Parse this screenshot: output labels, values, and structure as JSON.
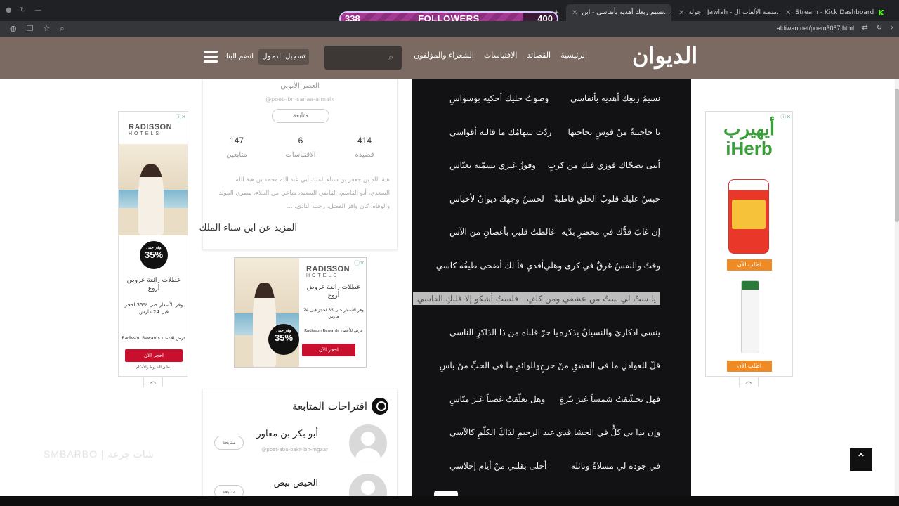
{
  "browser": {
    "tabs": [
      {
        "label": "تسيم ربعك أهديه بأنفاسي - ابن...",
        "active": true
      },
      {
        "label": "جولة | Jawlah - منصة الألعاب ال...",
        "active": false
      },
      {
        "label": "Stream - Kick Dashboard",
        "active": false
      }
    ],
    "url": "aldiwan.net/poem3057.html"
  },
  "followers_overlay": {
    "current": "338",
    "label": "FOLLOWERS",
    "goal": "400",
    "progress": 0.845,
    "fill_color": "#8b2e7c"
  },
  "header": {
    "logo": "الديوان",
    "nav": [
      "الرئيسية",
      "القصائد",
      "الاقتباسات",
      "الشعراء والمؤلفون"
    ],
    "login": "تسجيل الدخول",
    "join": "انضم الينا",
    "bg_color": "#7a6a62"
  },
  "poet_card": {
    "era": "العصر الأيوبي",
    "handle": "@poet-ibn-sanaa-almalk",
    "follow": "متابعة",
    "stats": [
      {
        "number": "414",
        "label": "قصيدة"
      },
      {
        "number": "6",
        "label": "الاقتباسات"
      },
      {
        "number": "147",
        "label": "متابعين"
      }
    ],
    "bio": "هبة الله بن جعفر بن سناء الملك أبي عبد الله محمد بن هبة الله السعدي، أبو القاسم، القاضي السعيد، شاعر، من النبلاء، مصري المولد والوفاة، كان وافر الفضل، رحب النادي، ...",
    "more_link": "المزيد عن ابن سناء الملك"
  },
  "poem": {
    "verses": [
      {
        "right": "نسيمُ ربعِك أهديه بأنفاسي",
        "left": "وصوتُ حليك أحكيه بوسواسِ",
        "highlight": false
      },
      {
        "right": "يا حاجبيةُ منْ قوسٍ بحاجبها",
        "left": "ردّت سهامُك ما قالته أقواسي",
        "highlight": false
      },
      {
        "right": "أتنى يضحّاك قوزي فيك من كربٍ",
        "left": "وفوزُ غيري يسمّيه بعبّاسِ",
        "highlight": false
      },
      {
        "right": "حبسُ عليك قلوبُ الخلقِ قاطبةً",
        "left": "لحسنُ وجهك ديوانٌ لأخياسِ",
        "highlight": false
      },
      {
        "right": "إن غابَ قدُّك في محضرٍ بدّيه",
        "left": "غالطتُ قلبي بأغصانٍ من الآسِ",
        "highlight": false
      },
      {
        "right": "وقتُ والنفسُ غرقٌ في كرى وهلي",
        "left": "أفديِ فأ لك أضحى طيفُه كاسي",
        "highlight": false
      },
      {
        "right": "يا ستُ لي ستٌ من عشقي ومن كلفٍ",
        "left": "فلستُ أشكو إلا قلبكِ القاسي",
        "highlight": true
      },
      {
        "right": "ينسى اذكاريَ والنسيانُ يذكره",
        "left": "يا حرّ قلباه من ذا الذاكرِ الناسي",
        "highlight": false
      },
      {
        "right": "قلْ للعواذلِ ما في العشقِ منْ حرجٍ",
        "left": "وللوائمِ ما في الحبِّ منْ باسِ",
        "highlight": false
      },
      {
        "right": "فهل تحشّقتُ شمساً غيرَ نيّرةٍ",
        "left": "وهل تعلّقتُ غصناً غيرَ ميّاسِ",
        "highlight": false
      },
      {
        "right": "وإن بدا بي كلُّ في الحشا قدي",
        "left": "عبد الرحيمِ لذاكَ الكلّمِ كالآسي",
        "highlight": false
      },
      {
        "right": "في جوده لي مسلاةٌ ونائله",
        "left": "أحلى بقلبي منْ أيامِ إخلاسي",
        "highlight": false
      }
    ]
  },
  "ads": {
    "left": {
      "brand": "RADISSON",
      "brand_sub": "HOTELS",
      "discount": "35%",
      "discount_tag": "وفر حتى",
      "headline": "عطلات رائعة عروض أروع",
      "detail": "وفر الأسعار حتى %35 احجز قبل 24 مارس",
      "footer": "عرض للأعضاء Radisson Rewards",
      "cta": "احجز الآن",
      "terms": "تنطبق الشروط والأحكام"
    },
    "middle": {
      "brand": "RADISSON",
      "brand_sub": "HOTELS",
      "discount": "35%",
      "discount_tag": "وفر حتى",
      "headline": "عطلات رائعة عروض أروع",
      "detail": "وفر الأسعار حتى 35 احجز قبل 24 مارس",
      "footer": "عرض للأعضاء Radisson Rewards",
      "cta": "احجز الآن"
    },
    "right": {
      "brand_ar": "أيهيرب",
      "brand": "iHerb",
      "cta1": "اطلب الآن",
      "cta2": "اطلب الآن"
    }
  },
  "suggestions": {
    "title": "اقتراحات المتابعة",
    "items": [
      {
        "name": "أبو بكر بن مغاور",
        "handle": "@poet-abu-bakr-ibn-mgaar",
        "follow": "متابعة"
      },
      {
        "name": "الحيص بيص",
        "handle": "",
        "follow": "متابعة"
      }
    ]
  },
  "watermark": "SMBARBO | شات جرعة"
}
